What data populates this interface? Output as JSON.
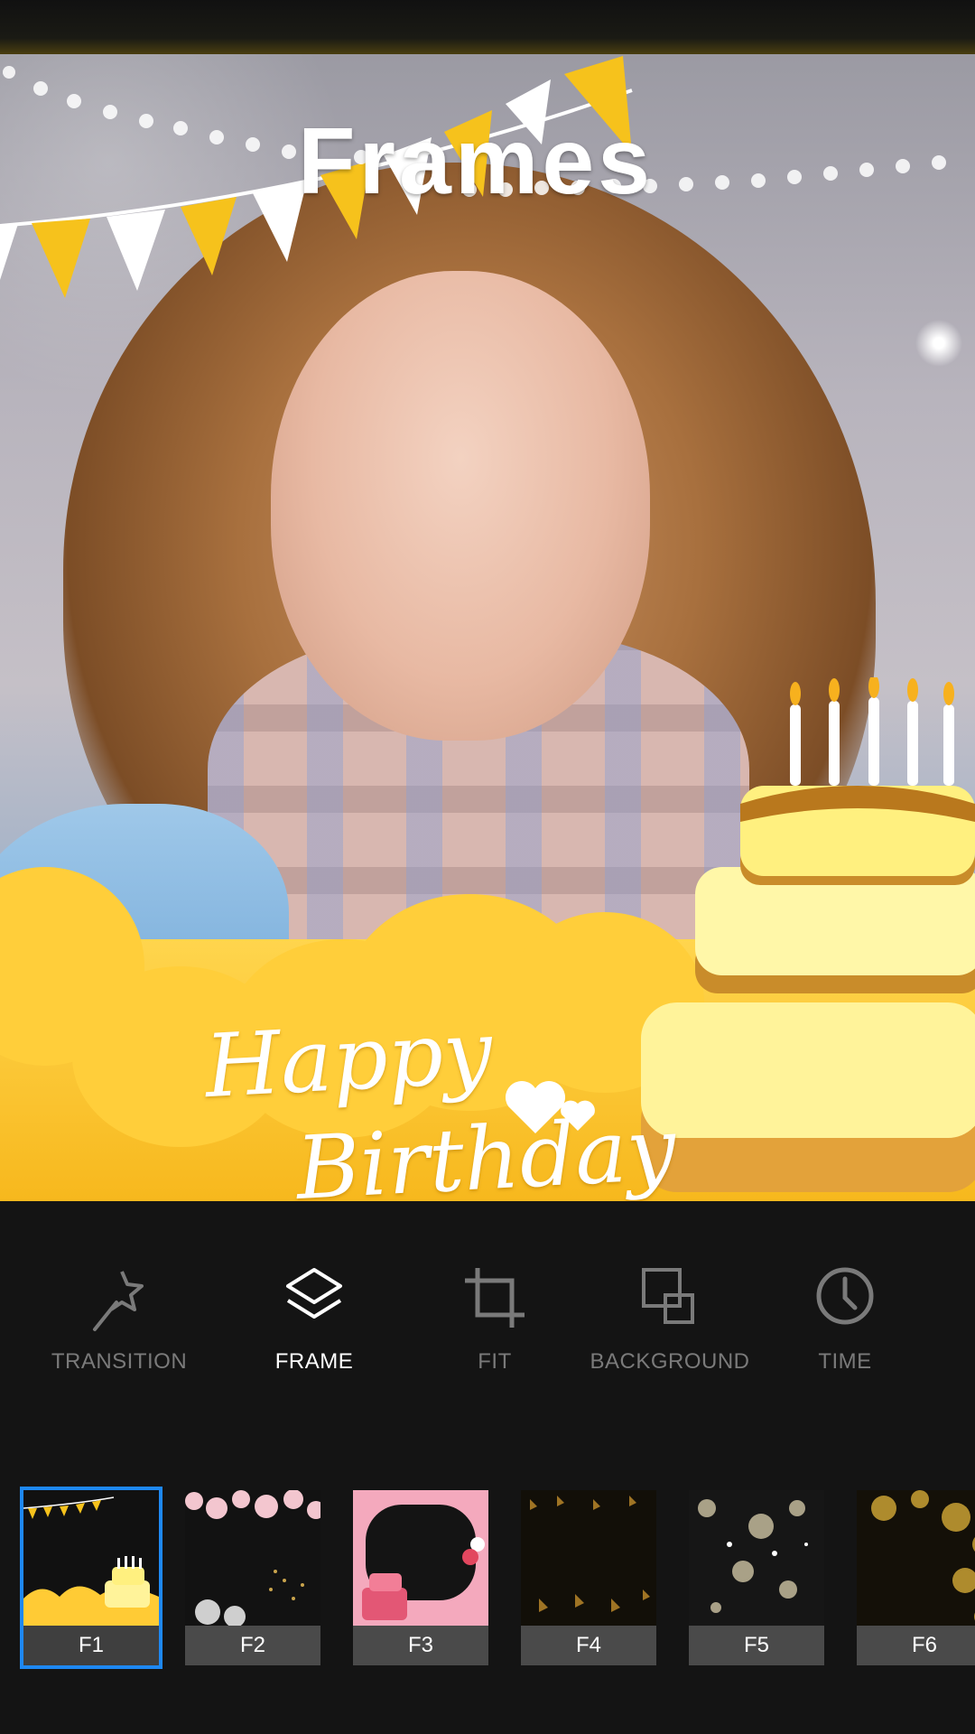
{
  "preview": {
    "title": "Frames",
    "frame_text_line1": "Happy",
    "frame_text_line2": "Birthday"
  },
  "toolbar": {
    "items": [
      {
        "label": "TRANSITION",
        "icon": "magic-wand-icon",
        "active": false
      },
      {
        "label": "FRAME",
        "icon": "layers-icon",
        "active": true
      },
      {
        "label": "FIT",
        "icon": "crop-icon",
        "active": false
      },
      {
        "label": "BACKGROUND",
        "icon": "background-squares-icon",
        "active": false
      },
      {
        "label": "TIME",
        "icon": "clock-icon",
        "active": false
      }
    ]
  },
  "frames": {
    "selected": "F1",
    "items": [
      {
        "label": "F1"
      },
      {
        "label": "F2"
      },
      {
        "label": "F3"
      },
      {
        "label": "F4"
      },
      {
        "label": "F5"
      },
      {
        "label": "F6"
      }
    ]
  },
  "colors": {
    "background": "#141414",
    "accent": "#1e88f2",
    "frame_yellow": "#ffce3a",
    "inactive_text": "#7a7a7a"
  }
}
